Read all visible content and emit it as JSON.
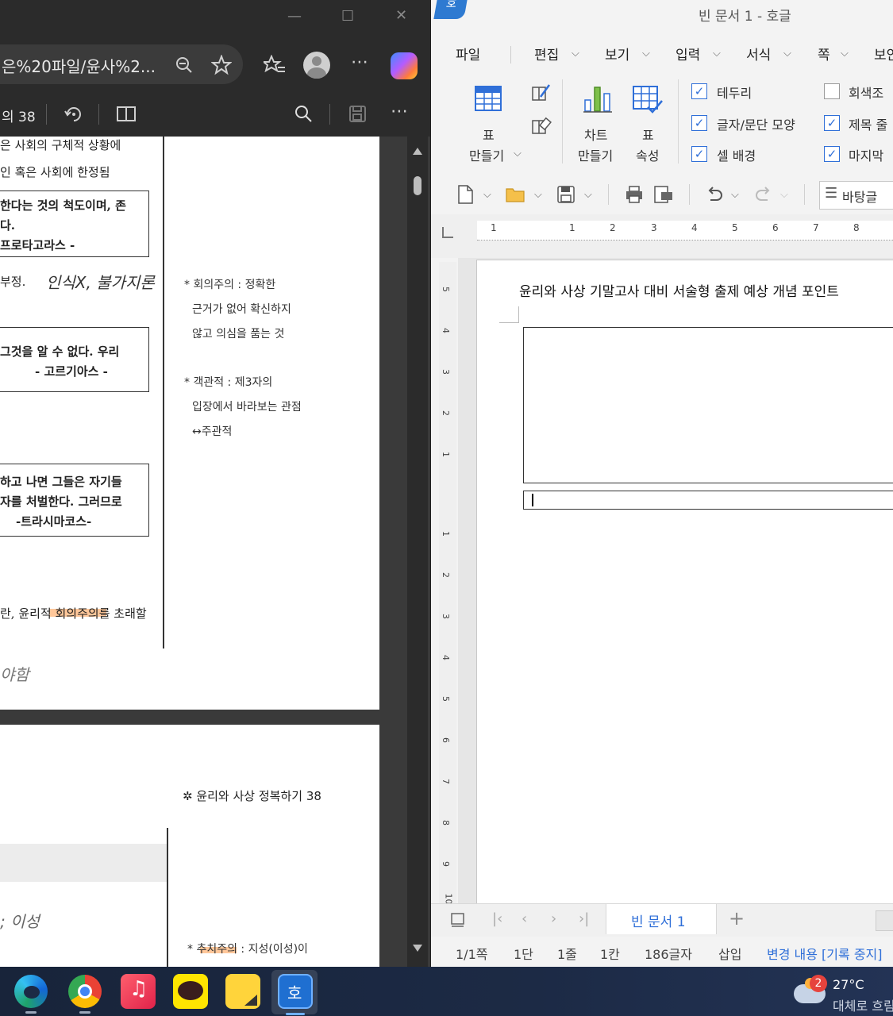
{
  "edge": {
    "window_controls": {
      "minimize": "—",
      "maximize": "☐",
      "close": "✕"
    },
    "address_text": "은%20파일/윤사%2...",
    "pdf_toolbar": {
      "page_label": "의 38"
    },
    "pdf_content": {
      "top_line1": "은 사회의 구체적 상황에",
      "top_line2": "인 혹은 사회에 한정됨",
      "box1_line1": "한다는 것의 척도이며, 존",
      "box1_line2": "다.",
      "box1_line3": "프로타고라스 -",
      "handwriting1": "부정.",
      "handwriting1b": "인식X, 불가지론",
      "box2_line1": "그것을 알 수 없다. 우리",
      "box2_line2": "- 고르기아스 -",
      "box3_line1": "하고 나면 그들은 자기들",
      "box3_line2": "자를 처벌한다. 그러므로",
      "box3_line3": "-트라시마코스-",
      "bottom_line": "란, 윤리적 회의주의를 초래할",
      "handwriting2": "야함",
      "note1_line1": "* 회의주의 : 정확한",
      "note1_line2": "근거가 없어 확신하지",
      "note1_line3": "않고 의심을 품는 것",
      "note2_line1": "* 객관적 : 제3자의",
      "note2_line2": "입장에서 바라보는 관점",
      "note2_line3": "↔주관적",
      "page2_header": "✲ 윤리와 사상 정복하기 38",
      "page2_hand": "; 이성",
      "page2_note": "* 추치주의 : 지성(이성)이"
    }
  },
  "hwp": {
    "logo": "호",
    "title": "빈 문서 1 - 호글",
    "menus": [
      "파일",
      "편집",
      "보기",
      "입력",
      "서식",
      "쪽",
      "보안"
    ],
    "ribbon": {
      "table_make": [
        "표",
        "만들기"
      ],
      "chart_make": [
        "차트",
        "만들기"
      ],
      "table_props": [
        "표",
        "속성"
      ],
      "checks": [
        {
          "label": "테두리",
          "checked": true
        },
        {
          "label": "글자/문단 모양",
          "checked": true
        },
        {
          "label": "셀 배경",
          "checked": true
        },
        {
          "label": "회색조",
          "checked": false
        },
        {
          "label": "제목 줄",
          "checked": true
        },
        {
          "label": "마지막",
          "checked": true
        }
      ]
    },
    "style_box": "바탕글",
    "ruler_numbers": [
      "1",
      "1",
      "2",
      "3",
      "4",
      "5",
      "6",
      "7",
      "8"
    ],
    "vruler_numbers": [
      "5",
      "4",
      "3",
      "2",
      "1",
      "1",
      "2",
      "3",
      "4",
      "5",
      "6",
      "7",
      "8",
      "9",
      "10"
    ],
    "doc_title": "윤리와 사상 기말고사 대비 서술형 출제 예상 개념 포인트",
    "tab_name": "빈 문서 1",
    "status": {
      "page": "1/1쪽",
      "column": "1단",
      "line": "1줄",
      "cell": "1칸",
      "chars": "186글자",
      "mode": "삽입",
      "track": "변경 내용 [기록 중지]"
    }
  },
  "taskbar": {
    "weather_temp": "27°C",
    "weather_desc": "대체로 흐림",
    "badge_count": "2",
    "colors": {
      "accent": "#2f6fd8",
      "hwp_blue": "#2e7ad1"
    }
  }
}
